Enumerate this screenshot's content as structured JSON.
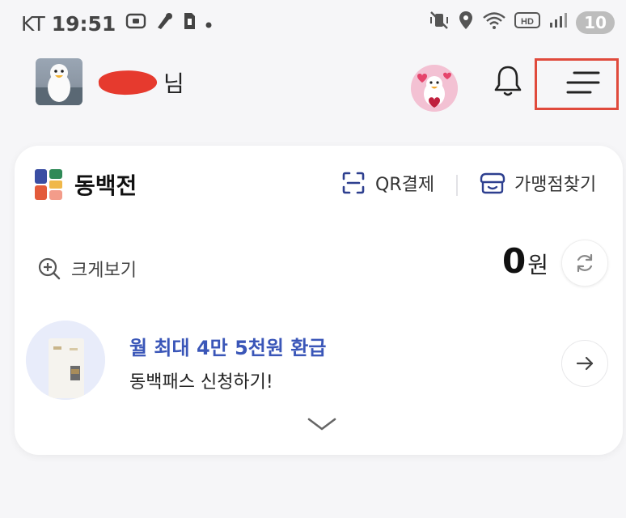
{
  "status_bar": {
    "carrier": "KT",
    "time": "19:51",
    "battery_level": "10",
    "icons_left": [
      "screen-record-icon",
      "paint-icon",
      "sim-icon",
      "dot-icon"
    ],
    "icons_right": [
      "mute-vibrate-icon",
      "location-icon",
      "wifi-icon",
      "hd-icon",
      "signal-icon"
    ]
  },
  "header": {
    "greeting_suffix": "님",
    "icons": [
      "profile-avatar",
      "mascot-avatar",
      "bell-icon",
      "menu-icon"
    ],
    "highlight_color": "#e04a3c"
  },
  "card": {
    "brand_name": "동백전",
    "qr_pay_label": "QR결제",
    "store_finder_label": "가맹점찾기",
    "zoom_label": "크게보기",
    "balance_amount": "0",
    "balance_unit": "원",
    "promo": {
      "title": "월 최대 4만 5천원 환급",
      "subtitle": "동백패스 신청하기!"
    }
  },
  "colors": {
    "accent_blue": "#3a56b8",
    "background": "#f6f6f8",
    "card": "#ffffff"
  }
}
